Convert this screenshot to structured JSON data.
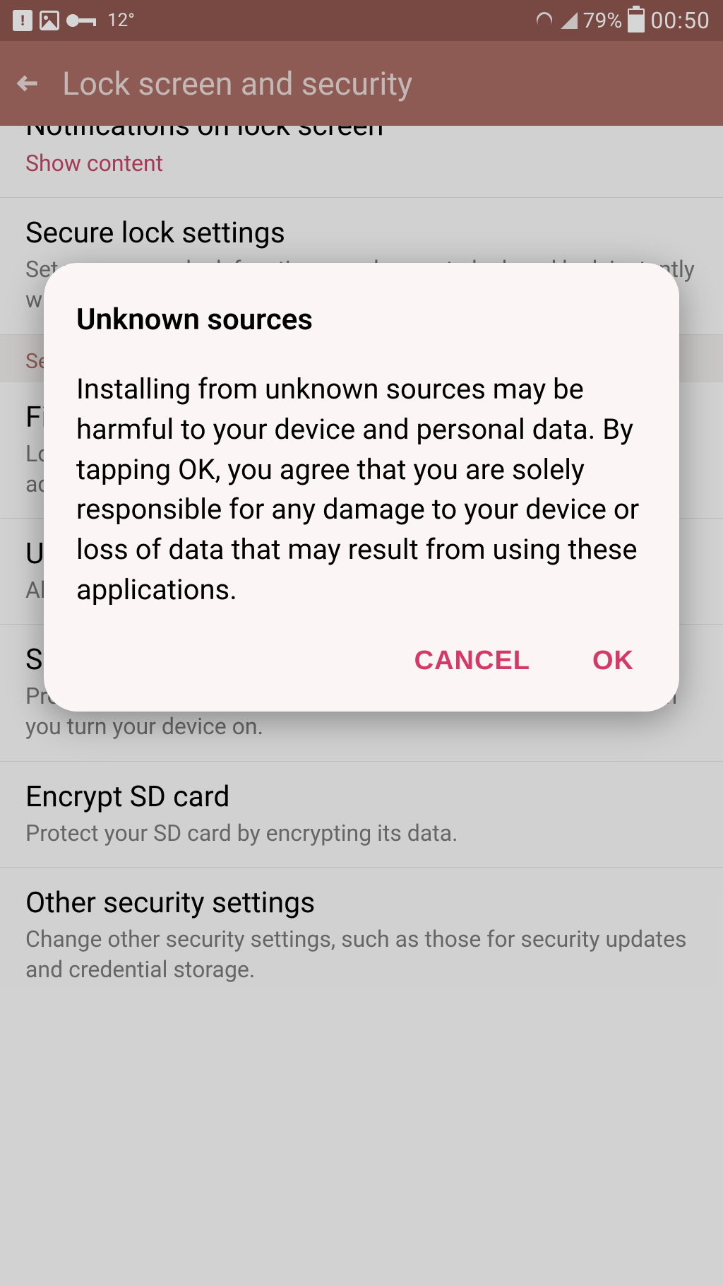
{
  "status_bar": {
    "temperature": "12°",
    "battery_percent": "79%",
    "time": "00:50"
  },
  "app_bar": {
    "title": "Lock screen and security"
  },
  "settings": {
    "item0": {
      "title": "Notifications on lock screen",
      "subtitle": "Show content"
    },
    "item1": {
      "title": "Secure lock settings",
      "subtitle": "Set your secure lock functions, such as auto lock and lock instantly with power key."
    },
    "item2_header": "Security",
    "item2": {
      "title": "Find My Mobile",
      "subtitle": "Locate and control your phone remotely using your Samsung account."
    },
    "item3": {
      "title": "Unknown sources",
      "subtitle": "Allow installation of apps from sources other than the Play Store."
    },
    "item4": {
      "title": "Secure startup",
      "subtitle": "Protect your device by requiring a PIN, pattern, or password when you turn your device on."
    },
    "item5": {
      "title": "Encrypt SD card",
      "subtitle": "Protect your SD card by encrypting its data."
    },
    "item6": {
      "title": "Other security settings",
      "subtitle": "Change other security settings, such as those for security updates and credential storage."
    }
  },
  "dialog": {
    "title": "Unknown sources",
    "body": "Installing from unknown sources may be harmful to your device and personal data. By tapping OK, you agree that you are solely responsible for any damage to your device or loss of data that may result from using these applications.",
    "cancel": "CANCEL",
    "ok": "OK"
  }
}
